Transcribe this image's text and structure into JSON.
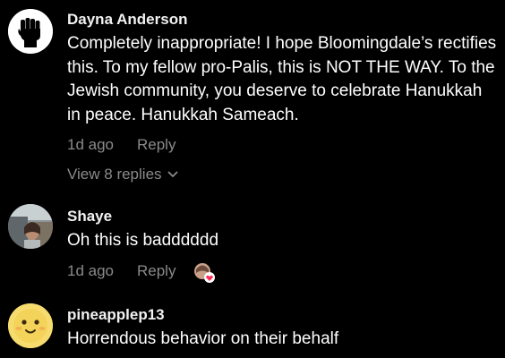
{
  "comments": [
    {
      "username": "Dayna Anderson",
      "text": "Completely inappropriate! I hope Bloomingdale’s rectifies this. To my fellow pro-Palis, this is NOT THE WAY. To the Jewish community, you deserve to celebrate Hanukkah in peace. Hanukkah Sameach.",
      "time": "1d ago",
      "reply_label": "Reply",
      "view_replies_label": "View 8 replies",
      "avatar_icon": "raised-fist-icon"
    },
    {
      "username": "Shaye",
      "text": "Oh this is badddddd",
      "time": "1d ago",
      "reply_label": "Reply",
      "creator_liked_icon": "creator-liked-heart-icon"
    },
    {
      "username": "pineapplep13",
      "text": "Horrendous behavior on their behalf",
      "avatar_icon": "smiley-face-icon"
    }
  ],
  "colors": {
    "background": "#000000",
    "text": "#ffffff",
    "secondary": "#8a8a8a",
    "like_heart": "#fe2c55"
  }
}
